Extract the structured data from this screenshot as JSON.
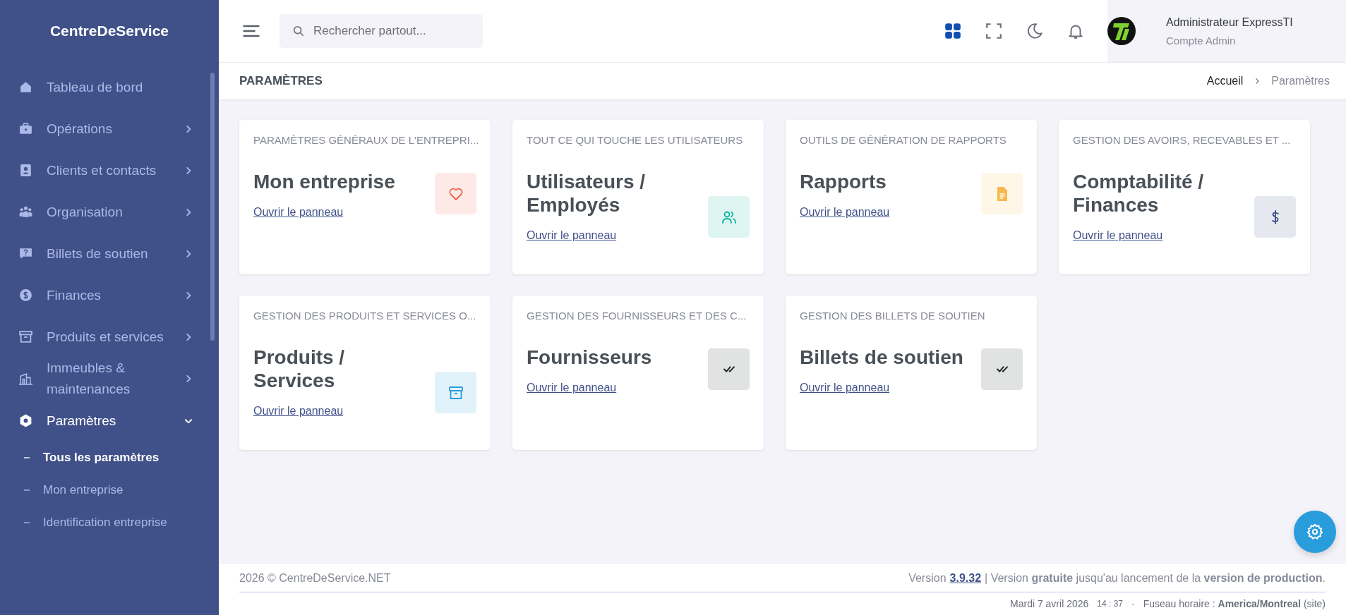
{
  "sidebar": {
    "brand": "CentreDeService",
    "items": [
      {
        "label": "Tableau de bord",
        "kind": "home"
      },
      {
        "label": "Opérations",
        "kind": "briefcase",
        "expanded": false
      },
      {
        "label": "Clients et contacts",
        "kind": "contact",
        "expanded": false
      },
      {
        "label": "Organisation",
        "kind": "team",
        "expanded": false
      },
      {
        "label": "Billets de soutien",
        "kind": "question",
        "expanded": false
      },
      {
        "label": "Finances",
        "kind": "dollar",
        "expanded": false
      },
      {
        "label": "Produits et services",
        "kind": "archive",
        "expanded": false
      },
      {
        "label": "Immeubles & maintenances",
        "kind": "building",
        "expanded": false
      },
      {
        "label": "Paramètres",
        "kind": "hexagon",
        "expanded": true,
        "children": [
          {
            "label": "Tous les paramètres",
            "selected": true
          },
          {
            "label": "Mon entreprise",
            "selected": false
          },
          {
            "label": "Identification entreprise",
            "selected": false
          }
        ]
      }
    ]
  },
  "topbar": {
    "search": {
      "placeholder": "Rechercher partout..."
    },
    "user": {
      "name": "Administrateur ExpressTI",
      "role": "Compte Admin"
    }
  },
  "page": {
    "title": "PARAMÈTRES",
    "breadcrumb": [
      {
        "label": "Accueil",
        "selected": false
      },
      {
        "label": "Paramètres",
        "selected": true
      }
    ]
  },
  "cards": [
    {
      "subtitle": "PARAMÈTRES GÉNÉRAUX DE L'ENTREPRI...",
      "title": "Mon entreprise",
      "link": "Ouvrir le panneau",
      "kind": "heart",
      "color": "#f06548"
    },
    {
      "subtitle": "TOUT CE QUI TOUCHE LES UTILISATEURS",
      "title": "Utilisateurs / Employés",
      "link": "Ouvrir le panneau",
      "kind": "users",
      "color": "#0ab39c"
    },
    {
      "subtitle": "OUTILS DE GÉNÉRATION DE RAPPORTS",
      "title": "Rapports",
      "link": "Ouvrir le panneau",
      "kind": "file",
      "color": "#f7b84b"
    },
    {
      "subtitle": "GESTION DES AVOIRS, RECEVABLES ET ...",
      "title": "Comptabilité / Finances",
      "link": "Ouvrir le panneau",
      "kind": "dollar",
      "color": "#405189"
    },
    {
      "subtitle": "GESTION DES PRODUITS ET SERVICES O...",
      "title": "Produits / Services",
      "link": "Ouvrir le panneau",
      "kind": "archive",
      "color": "#299cdb"
    },
    {
      "subtitle": "GESTION DES FOURNISSEURS ET DES C...",
      "title": "Fournisseurs",
      "link": "Ouvrir le panneau",
      "kind": "checks",
      "color": "#212529"
    },
    {
      "subtitle": "GESTION DES BILLETS DE SOUTIEN",
      "title": "Billets de soutien",
      "link": "Ouvrir le panneau",
      "kind": "checks",
      "color": "#212529"
    }
  ],
  "footer": {
    "copyright": "2026 © CentreDeService.NET",
    "version_prefix": "Version",
    "version": "3.9.32",
    "version_note": "| Version **gratuite** jusqu'au lancement de la **version de production**.",
    "date": "Mardi 7 avril 2026",
    "time": "14 : 37",
    "separator": "·",
    "timezone": "Fuseau horaire : **America/Montreal** (site)"
  }
}
